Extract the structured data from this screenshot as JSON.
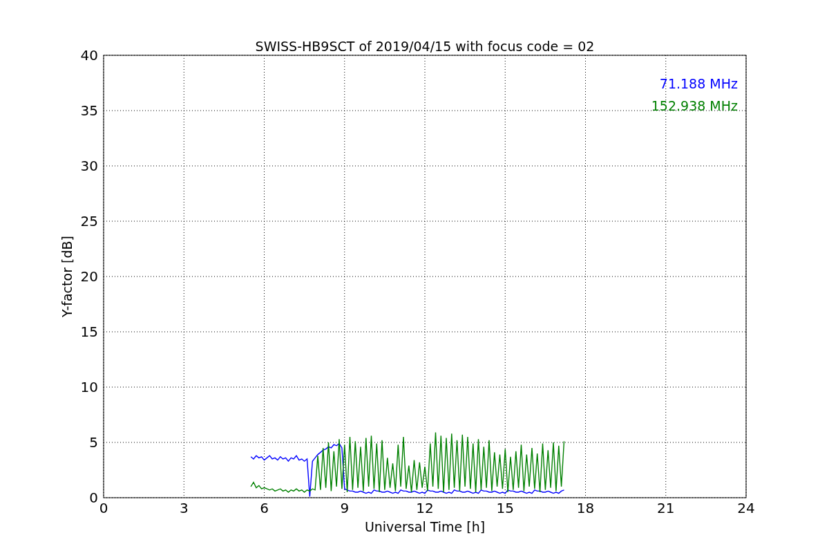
{
  "chart_data": {
    "type": "line",
    "title": "SWISS-HB9SCT of 2019/04/15 with focus code = 02",
    "xlabel": "Universal Time [h]",
    "ylabel": "Y-factor [dB]",
    "xlim": [
      0,
      24
    ],
    "ylim": [
      0,
      40
    ],
    "xticks": [
      0,
      3,
      6,
      9,
      12,
      15,
      18,
      21,
      24
    ],
    "yticks": [
      0,
      5,
      10,
      15,
      20,
      25,
      30,
      35,
      40
    ],
    "grid": true,
    "x": [
      5.5,
      5.6,
      5.7,
      5.8,
      5.9,
      6.0,
      6.1,
      6.2,
      6.3,
      6.4,
      6.5,
      6.6,
      6.7,
      6.8,
      6.9,
      7.0,
      7.1,
      7.2,
      7.3,
      7.4,
      7.5,
      7.6,
      7.7,
      7.8,
      7.9,
      8.0,
      8.1,
      8.2,
      8.3,
      8.4,
      8.5,
      8.6,
      8.7,
      8.8,
      8.9,
      9.0,
      9.1,
      9.2,
      9.3,
      9.4,
      9.5,
      9.6,
      9.7,
      9.8,
      9.9,
      10.0,
      10.1,
      10.2,
      10.3,
      10.4,
      10.5,
      10.6,
      10.7,
      10.8,
      10.9,
      11.0,
      11.1,
      11.2,
      11.3,
      11.4,
      11.5,
      11.6,
      11.7,
      11.8,
      11.9,
      12.0,
      12.1,
      12.2,
      12.3,
      12.4,
      12.5,
      12.6,
      12.7,
      12.8,
      12.9,
      13.0,
      13.1,
      13.2,
      13.3,
      13.4,
      13.5,
      13.6,
      13.7,
      13.8,
      13.9,
      14.0,
      14.1,
      14.2,
      14.3,
      14.4,
      14.5,
      14.6,
      14.7,
      14.8,
      14.9,
      15.0,
      15.1,
      15.2,
      15.3,
      15.4,
      15.5,
      15.6,
      15.7,
      15.8,
      15.9,
      16.0,
      16.1,
      16.2,
      16.3,
      16.4,
      16.5,
      16.6,
      16.7,
      16.8,
      16.9,
      17.0,
      17.1,
      17.2
    ],
    "series": [
      {
        "name": "71.188 MHz",
        "color": "#0000ff",
        "values": [
          3.7,
          3.5,
          3.8,
          3.6,
          3.7,
          3.4,
          3.6,
          3.8,
          3.5,
          3.6,
          3.4,
          3.7,
          3.5,
          3.6,
          3.3,
          3.6,
          3.5,
          3.8,
          3.4,
          3.5,
          3.3,
          3.5,
          0.1,
          3.3,
          3.6,
          3.9,
          4.1,
          4.3,
          4.4,
          4.6,
          4.5,
          4.8,
          4.7,
          4.9,
          4.5,
          0.8,
          0.7,
          0.6,
          0.6,
          0.5,
          0.5,
          0.6,
          0.5,
          0.4,
          0.5,
          0.4,
          0.7,
          0.6,
          0.6,
          0.5,
          0.5,
          0.6,
          0.5,
          0.4,
          0.5,
          0.4,
          0.7,
          0.6,
          0.6,
          0.5,
          0.5,
          0.6,
          0.5,
          0.4,
          0.5,
          0.4,
          0.7,
          0.6,
          0.6,
          0.5,
          0.5,
          0.6,
          0.5,
          0.4,
          0.5,
          0.4,
          0.7,
          0.6,
          0.6,
          0.5,
          0.5,
          0.6,
          0.5,
          0.4,
          0.5,
          0.4,
          0.7,
          0.6,
          0.6,
          0.5,
          0.5,
          0.6,
          0.5,
          0.4,
          0.5,
          0.4,
          0.7,
          0.6,
          0.6,
          0.5,
          0.5,
          0.6,
          0.5,
          0.4,
          0.5,
          0.4,
          0.7,
          0.6,
          0.6,
          0.5,
          0.5,
          0.6,
          0.5,
          0.4,
          0.5,
          0.4,
          0.6,
          0.7
        ]
      },
      {
        "name": "152.938 MHz",
        "color": "#008000",
        "values": [
          1.0,
          1.4,
          0.9,
          1.1,
          0.8,
          0.9,
          0.8,
          0.7,
          0.8,
          0.6,
          0.7,
          0.8,
          0.6,
          0.7,
          0.5,
          0.7,
          0.6,
          0.8,
          0.6,
          0.7,
          0.5,
          0.7,
          0.6,
          0.8,
          0.7,
          3.8,
          0.7,
          4.5,
          0.9,
          5.0,
          0.6,
          4.2,
          1.0,
          5.3,
          0.8,
          4.8,
          0.5,
          5.5,
          0.7,
          5.1,
          0.9,
          4.6,
          0.6,
          5.4,
          1.0,
          5.6,
          0.8,
          4.9,
          0.5,
          5.2,
          0.7,
          3.6,
          0.9,
          3.1,
          0.6,
          4.8,
          1.0,
          5.5,
          0.8,
          2.9,
          0.5,
          3.4,
          0.7,
          3.2,
          0.9,
          2.8,
          0.6,
          4.9,
          1.0,
          5.9,
          0.8,
          5.6,
          0.5,
          5.4,
          0.7,
          5.8,
          0.9,
          5.2,
          0.6,
          5.7,
          1.0,
          5.5,
          0.8,
          4.9,
          0.5,
          5.3,
          0.7,
          4.6,
          0.9,
          5.2,
          0.6,
          4.1,
          1.0,
          3.9,
          0.8,
          4.4,
          0.5,
          3.7,
          0.7,
          4.2,
          0.9,
          4.8,
          0.6,
          3.9,
          1.0,
          4.5,
          0.8,
          4.0,
          0.5,
          4.9,
          0.7,
          4.3,
          0.9,
          5.0,
          0.6,
          4.7,
          1.0,
          5.1
        ]
      }
    ]
  }
}
